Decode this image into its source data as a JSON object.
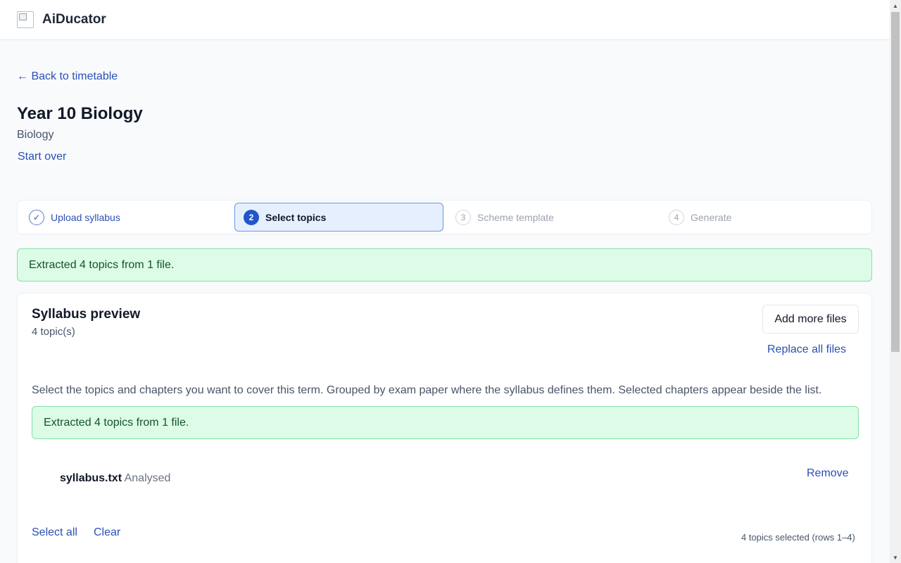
{
  "header": {
    "brand": "AiDucator",
    "logo_icon": "broken-image-icon"
  },
  "nav": {
    "back_link": "← Back to timetable"
  },
  "page": {
    "title": "Year 10 Biology",
    "subject": "Biology",
    "start_over": "Start over"
  },
  "stepper": {
    "steps": [
      {
        "marker": "✓",
        "label": "Upload syllabus",
        "state": "completed"
      },
      {
        "marker": "2",
        "label": "Select topics",
        "state": "active"
      },
      {
        "marker": "3",
        "label": "Scheme template",
        "state": "upcoming"
      },
      {
        "marker": "4",
        "label": "Generate",
        "state": "upcoming"
      }
    ]
  },
  "alerts": {
    "top": "Extracted 4 topics from 1 file.",
    "inner": "Extracted 4 topics from 1 file."
  },
  "syllabus_card": {
    "title": "Syllabus preview",
    "count": "4 topic(s)",
    "add_files": "Add more files",
    "replace_files": "Replace all files",
    "instructions": "Select the topics and chapters you want to cover this term. Grouped by exam paper where the syllabus defines them. Selected chapters appear beside the list.",
    "file": {
      "name": "syllabus.txt",
      "status": "Analysed",
      "remove": "Remove"
    },
    "select_all": "Select all",
    "clear": "Clear",
    "selected_count": "4 topics selected (rows 1–4)"
  },
  "colors": {
    "link": "#2b50b5",
    "active_step": "#2255c9",
    "success_bg": "#dcfce7",
    "success_border": "#86e0a5"
  }
}
